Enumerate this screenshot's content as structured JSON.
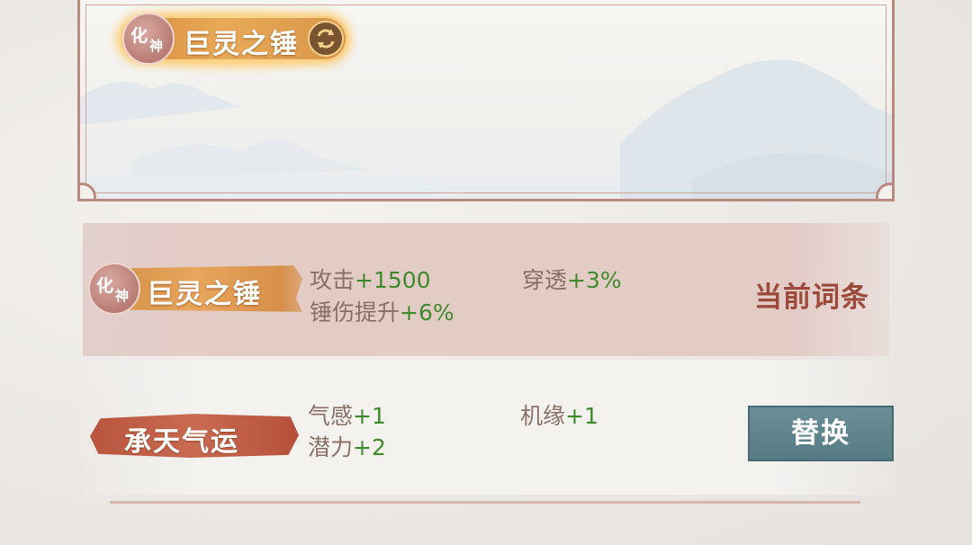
{
  "preview": {
    "skill_rank_char1": "化",
    "skill_rank_char2": "神",
    "skill_name": "巨灵之锤"
  },
  "current_row": {
    "rank_char1": "化",
    "rank_char2": "神",
    "name": "巨灵之锤",
    "stats": [
      {
        "label": "攻击",
        "value": "+1500"
      },
      {
        "label": "穿透",
        "value": "+3%"
      },
      {
        "label": "锤伤提升",
        "value": "+6%"
      }
    ],
    "status": "当前词条"
  },
  "alt_row": {
    "name": "承天气运",
    "stats": [
      {
        "label": "气感",
        "value": "+1"
      },
      {
        "label": "机缘",
        "value": "+1"
      },
      {
        "label": "潜力",
        "value": "+2"
      }
    ],
    "button_label": "替换"
  },
  "colors": {
    "stat_label": "#8a6f66",
    "stat_value": "#3f8a2c",
    "status_text": "#9c4a3c",
    "replace_button": "#5f8690",
    "frame_border": "#b88a80"
  },
  "icons": {
    "refresh": "refresh-icon"
  }
}
